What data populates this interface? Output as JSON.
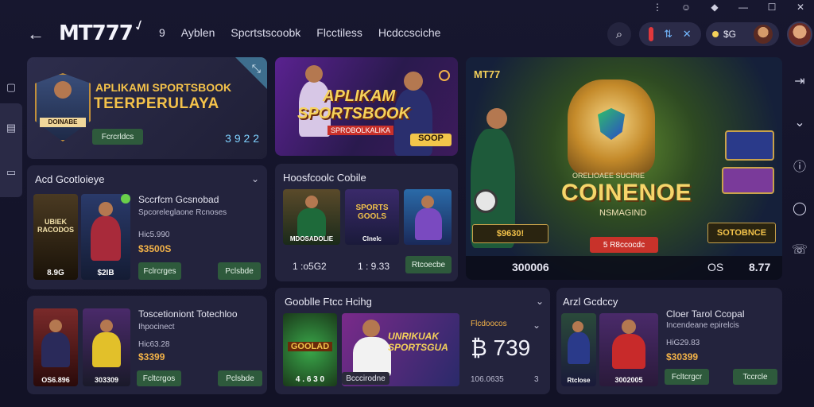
{
  "window_controls": [
    "⋮",
    "☺",
    "◆",
    "—",
    "☐",
    "✕"
  ],
  "header": {
    "back_icon": "arrow-left-icon",
    "logo": "MT777",
    "nav": [
      "9",
      "Ayblen",
      "Spcrtstscoobk",
      "Flcctiless",
      "Hcdccsciche"
    ],
    "balance": "$G",
    "pill_icon": "swap-icon"
  },
  "hero_left": {
    "line1": "APLIKAMI SPORTSBOOK",
    "line2": "TEERPERULAYA",
    "badge": "DOINABE",
    "button": "Fcrcrldcs",
    "value": "3 9 2 2"
  },
  "hero_mid": {
    "line1": "APLIKAM",
    "line2": "SPORTSBOOK",
    "sub": "SPROBOLKALIKA",
    "label": "SOOP"
  },
  "hero_right": {
    "logo": "MT77",
    "title": "COINENOE",
    "sub": "NSMAGIND",
    "tag": "ORELIOAEE SUCIRIE",
    "btn1": "$9630!",
    "btn2": "5 R8ccocdc",
    "btn3": "SOTOBNCE",
    "left_stat": "300006",
    "right_label": "OS",
    "right_value": "8.77"
  },
  "card_a": {
    "title": "Acd Gcotloieye",
    "item_title": "Sccrfcm Gcsnobad",
    "item_sub": "Spcoreleglaone Rcnoses",
    "meta": "Hic5.990",
    "price": "$3500S",
    "thumb1": "UBIEK RACODOS",
    "thumb1_val": "8.9G",
    "thumb2_val": "$2IB",
    "btn1": "Fclrcrges",
    "btn2": "Pclsbde"
  },
  "card_b": {
    "title": "Hoosfcoolc Cobile",
    "thumb_badge": "SPORTS GOOLS",
    "l1": "MDOSADOLIE",
    "l2": "Clnelc",
    "s1": "1 :o5G2",
    "s2": "1 : 9.33",
    "btn": "Rtcoecbe"
  },
  "card_c": {
    "title": "Toscetioniont Totechloo",
    "sub": "Ihpocinect",
    "meta": "Hic63.28",
    "price": "$3399",
    "v1": "OS6.896",
    "v2": "303309",
    "btn1": "Fcltcrgos",
    "btn2": "Pclsbde"
  },
  "card_d": {
    "title": "Gooblle Ftcc Hcihg",
    "badge_text": "GOOLAD",
    "banner": "UNRIKUAK SPORTSGUA",
    "odd": "4 . 6 3 0",
    "btn": "Bcccirodne",
    "side_label": "Flcdoocos",
    "big": "₿ 739",
    "foot": "106.0635",
    "foot_num": "3"
  },
  "card_e": {
    "title": "Arzl Gcdccy",
    "item_title": "Cloer Tarol Ccopal",
    "item_sub": "Incendeane epirelcis",
    "meta": "HiG29.83",
    "price": "$30399",
    "c1": "Rtclose",
    "c2": "3002005",
    "btn1": "Fcltcrgcr",
    "btn2": "Tccrcle"
  },
  "colors": {
    "accent_gold": "#f2b248",
    "btn_green": "#2e5a3c",
    "card": "#23233d",
    "bg": "#14142a"
  }
}
